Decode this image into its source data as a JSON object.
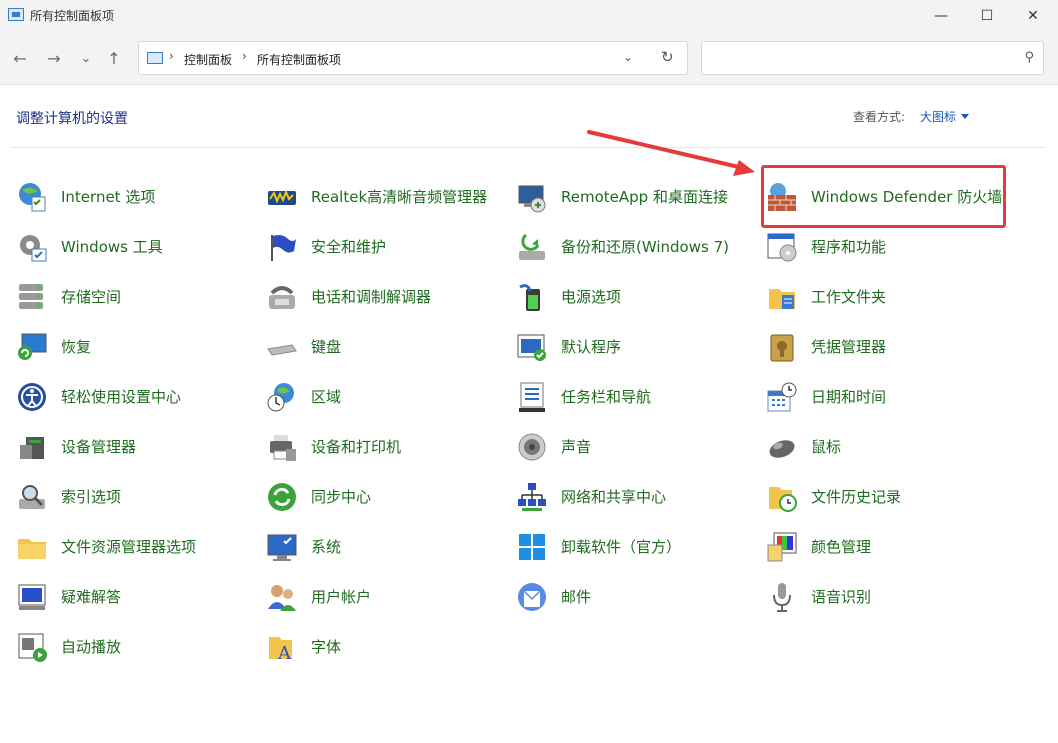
{
  "window": {
    "title": "所有控制面板项",
    "minimize_glyph": "—",
    "maximize_glyph": "☐",
    "close_glyph": "✕"
  },
  "toolbar": {
    "back_glyph": "←",
    "forward_glyph": "→",
    "recent_glyph": "⌄",
    "up_glyph": "↑",
    "breadcrumbs": [
      "控制面板",
      "所有控制面板项"
    ],
    "separator": "›",
    "dropdown_glyph": "⌄",
    "refresh_glyph": "↻",
    "search_value": "",
    "search_icon_glyph": "⚲"
  },
  "main": {
    "heading": "调整计算机的设置",
    "view_by_label": "查看方式:",
    "view_by_value": "大图标"
  },
  "items": [
    {
      "label": "Internet 选项",
      "icon": "internet-options-icon"
    },
    {
      "label": "Realtek高清晰音频管理器",
      "icon": "realtek-audio-icon"
    },
    {
      "label": "RemoteApp 和桌面连接",
      "icon": "remoteapp-icon"
    },
    {
      "label": "Windows Defender 防火墙",
      "icon": "firewall-icon"
    },
    {
      "label": "Windows 工具",
      "icon": "windows-tools-icon"
    },
    {
      "label": "安全和维护",
      "icon": "security-flag-icon"
    },
    {
      "label": "备份和还原(Windows 7)",
      "icon": "backup-icon"
    },
    {
      "label": "程序和功能",
      "icon": "programs-icon"
    },
    {
      "label": "存储空间",
      "icon": "storage-icon"
    },
    {
      "label": "电话和调制解调器",
      "icon": "phone-modem-icon"
    },
    {
      "label": "电源选项",
      "icon": "power-icon"
    },
    {
      "label": "工作文件夹",
      "icon": "work-folders-icon"
    },
    {
      "label": "恢复",
      "icon": "recovery-icon"
    },
    {
      "label": "键盘",
      "icon": "keyboard-icon"
    },
    {
      "label": "默认程序",
      "icon": "default-programs-icon"
    },
    {
      "label": "凭据管理器",
      "icon": "credential-icon"
    },
    {
      "label": "轻松使用设置中心",
      "icon": "ease-of-access-icon"
    },
    {
      "label": "区域",
      "icon": "region-icon"
    },
    {
      "label": "任务栏和导航",
      "icon": "taskbar-icon"
    },
    {
      "label": "日期和时间",
      "icon": "date-time-icon"
    },
    {
      "label": "设备管理器",
      "icon": "device-manager-icon"
    },
    {
      "label": "设备和打印机",
      "icon": "printer-icon"
    },
    {
      "label": "声音",
      "icon": "sound-icon"
    },
    {
      "label": "鼠标",
      "icon": "mouse-icon"
    },
    {
      "label": "索引选项",
      "icon": "indexing-icon"
    },
    {
      "label": "同步中心",
      "icon": "sync-icon"
    },
    {
      "label": "网络和共享中心",
      "icon": "network-icon"
    },
    {
      "label": "文件历史记录",
      "icon": "file-history-icon"
    },
    {
      "label": "文件资源管理器选项",
      "icon": "folder-options-icon"
    },
    {
      "label": "系统",
      "icon": "system-icon"
    },
    {
      "label": "卸载软件（官方）",
      "icon": "windows-logo-icon"
    },
    {
      "label": "颜色管理",
      "icon": "color-management-icon"
    },
    {
      "label": "疑难解答",
      "icon": "troubleshooting-icon"
    },
    {
      "label": "用户帐户",
      "icon": "user-accounts-icon"
    },
    {
      "label": "邮件",
      "icon": "mail-icon"
    },
    {
      "label": "语音识别",
      "icon": "microphone-icon"
    },
    {
      "label": "自动播放",
      "icon": "autoplay-icon"
    },
    {
      "label": "字体",
      "icon": "fonts-icon"
    }
  ],
  "colors": {
    "highlight": "#e5393b",
    "link_green": "#1f6b1f",
    "heading_blue": "#1e3287"
  }
}
